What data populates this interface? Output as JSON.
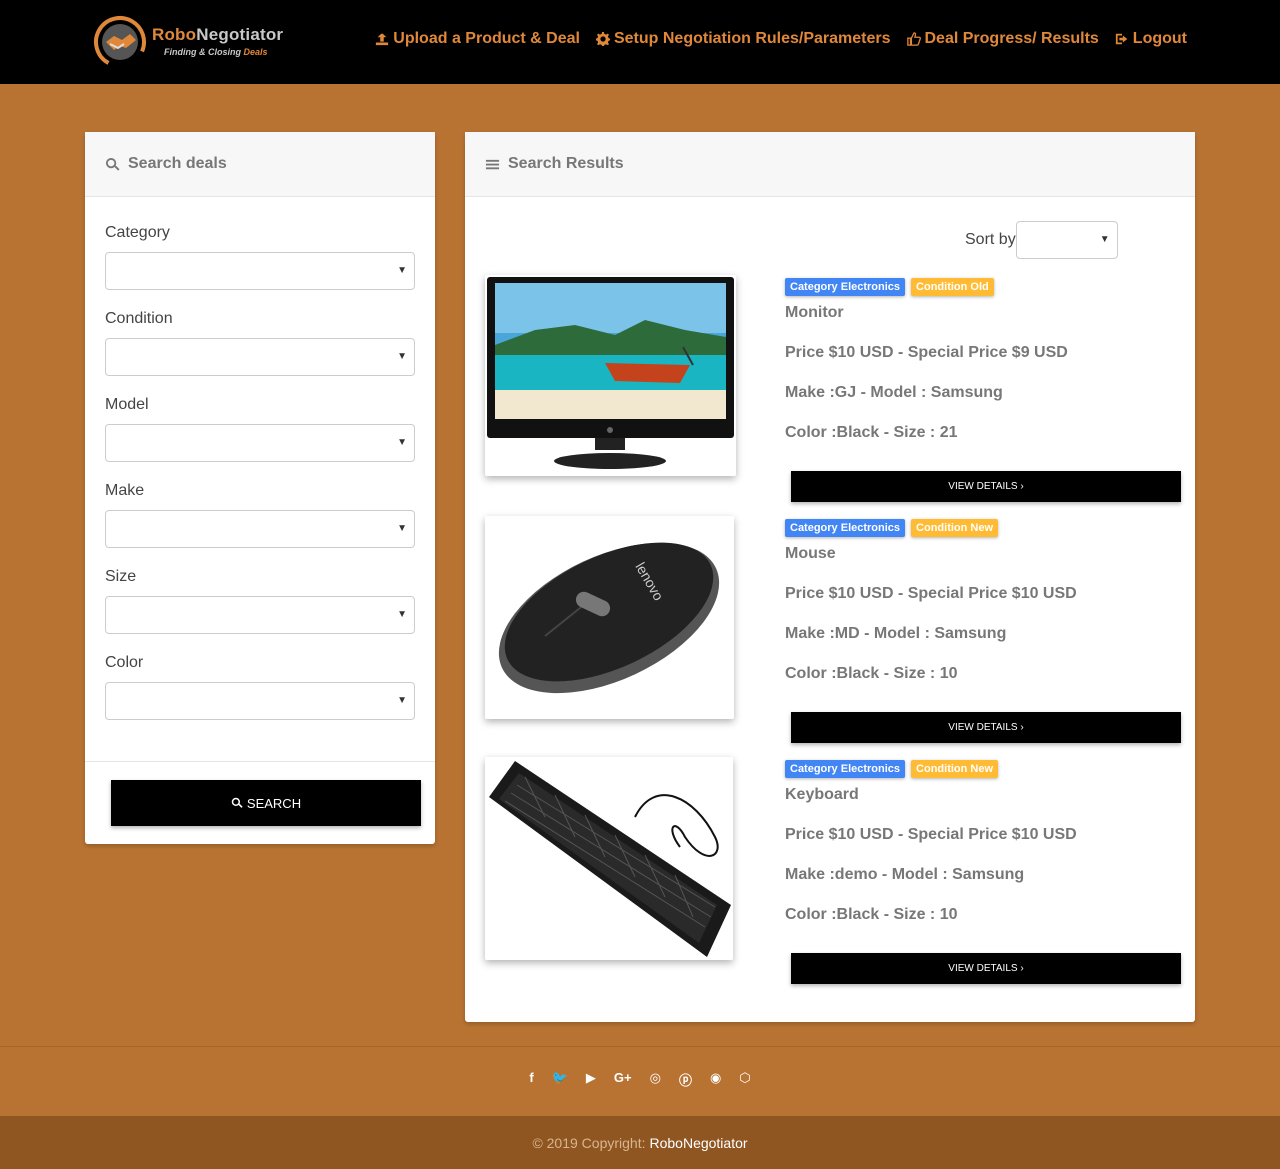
{
  "brand": {
    "name_part1": "Robo",
    "name_part2": "Negotiator",
    "tagline_part1": "Finding & Closing ",
    "tagline_part2": "Deals"
  },
  "nav": [
    {
      "label": "Upload a Product & Deal",
      "icon": "upload-icon"
    },
    {
      "label": "Setup Negotiation Rules/Parameters",
      "icon": "gear-icon"
    },
    {
      "label": "Deal Progress/ Results",
      "icon": "thumbs-up-icon"
    },
    {
      "label": "Logout",
      "icon": "sign-out-icon"
    }
  ],
  "search": {
    "title": "Search deals",
    "fields": [
      {
        "label": "Category",
        "value": ""
      },
      {
        "label": "Condition",
        "value": ""
      },
      {
        "label": "Model",
        "value": ""
      },
      {
        "label": "Make",
        "value": ""
      },
      {
        "label": "Size",
        "value": ""
      },
      {
        "label": "Color",
        "value": ""
      }
    ],
    "button": "SEARCH"
  },
  "results": {
    "title": "Search Results",
    "sort_label": "Sort by",
    "sort_value": "",
    "items": [
      {
        "category": "Category Electronics",
        "condition": "Condition Old",
        "name": "Monitor",
        "price": "Price $10 USD - Special Price $9 USD",
        "make_model": "Make :GJ - Model : Samsung",
        "color_size": "Color :Black - Size : 21",
        "button": "VIEW DETAILS ›"
      },
      {
        "category": "Category Electronics",
        "condition": "Condition New",
        "name": "Mouse",
        "price": "Price $10 USD - Special Price $10 USD",
        "make_model": "Make :MD - Model : Samsung",
        "color_size": "Color :Black - Size : 10",
        "button": "VIEW DETAILS ›"
      },
      {
        "category": "Category Electronics",
        "condition": "Condition New",
        "name": "Keyboard",
        "price": "Price $10 USD - Special Price $10 USD",
        "make_model": "Make :demo - Model : Samsung",
        "color_size": "Color :Black - Size : 10",
        "button": "VIEW DETAILS ›"
      }
    ]
  },
  "footer": {
    "socials": [
      "facebook-icon",
      "twitter-icon",
      "youtube-icon",
      "google-plus-icon",
      "dribbble-icon",
      "pinterest-icon",
      "github-icon",
      "codepen-icon"
    ],
    "social_glyphs": [
      "f",
      "🐦",
      "▶",
      "G+",
      "◎",
      "ⓟ",
      "◉",
      "⬡"
    ],
    "copyright_prefix": "© 2019 Copyright:",
    "copyright_name": "RoboNegotiator"
  },
  "colors": {
    "accent": "#e0883a",
    "background": "#b87333",
    "category_badge": "#4285f4",
    "condition_badge": "#ffbb33"
  }
}
